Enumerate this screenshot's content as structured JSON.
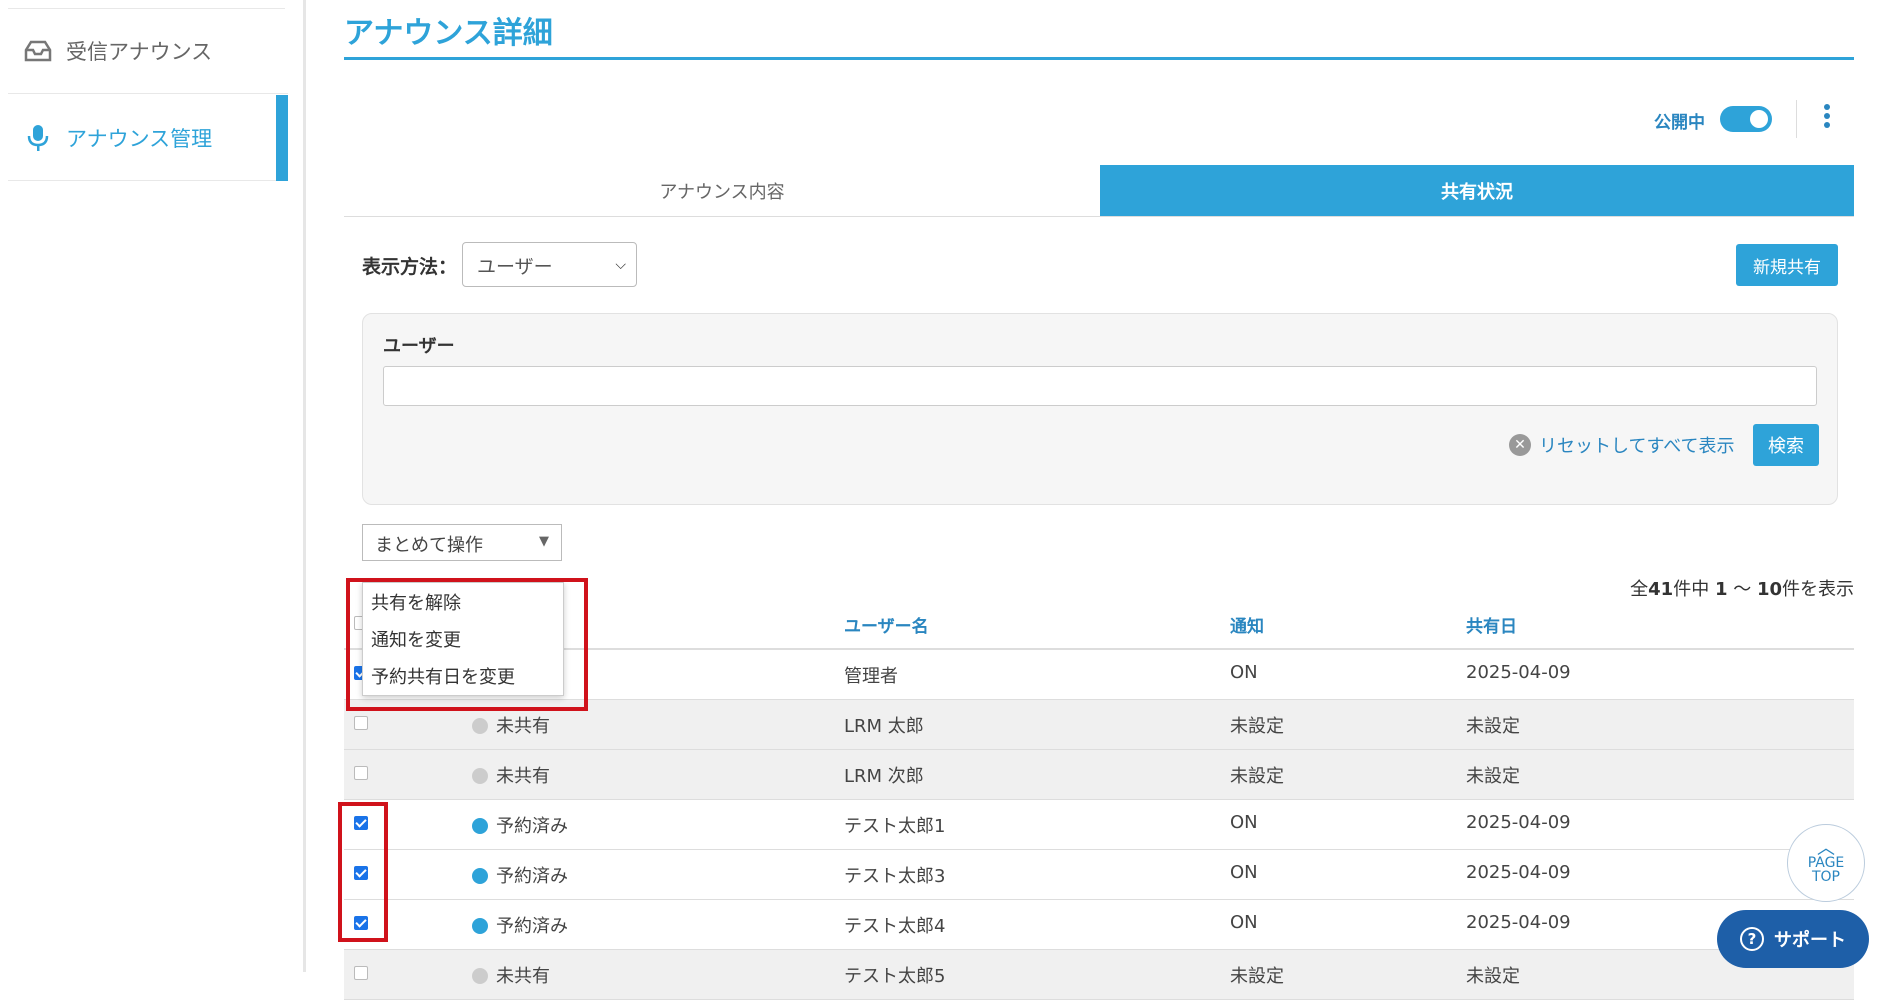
{
  "sidebar": {
    "items": [
      {
        "label": "受信アナウンス",
        "icon": "inbox-icon",
        "active": false
      },
      {
        "label": "アナウンス管理",
        "icon": "microphone-icon",
        "active": true
      }
    ]
  },
  "header": {
    "title": "アナウンス詳細",
    "publish_label": "公開中",
    "publish_on": true
  },
  "tabs": [
    {
      "label": "アナウンス内容",
      "active": false
    },
    {
      "label": "共有状況",
      "active": true
    }
  ],
  "display": {
    "label": "表示方法：",
    "selected": "ユーザー",
    "new_share_label": "新規共有"
  },
  "filter": {
    "label": "ユーザー",
    "value": "",
    "reset_label": "リセットしてすべて表示",
    "search_label": "検索"
  },
  "bulk": {
    "label": "まとめて操作",
    "options": [
      "共有を解除",
      "通知を変更",
      "予約共有日を変更"
    ]
  },
  "pager": {
    "prefix": "全",
    "total": "41",
    "mid1": "件中 ",
    "from": "1",
    "mid2": " ～ ",
    "to": "10",
    "suffix": "件を表示"
  },
  "table": {
    "columns": [
      "ユーザー名",
      "通知",
      "共有日"
    ],
    "rows": [
      {
        "checked": true,
        "status": "",
        "user": "管理者",
        "notify": "ON",
        "date": "2025-04-09",
        "gray": false
      },
      {
        "checked": false,
        "status": "未共有",
        "user": "LRM 太郎",
        "notify": "未設定",
        "date": "未設定",
        "gray": true
      },
      {
        "checked": false,
        "status": "未共有",
        "user": "LRM 次郎",
        "notify": "未設定",
        "date": "未設定",
        "gray": true
      },
      {
        "checked": true,
        "status": "予約済み",
        "user": "テスト太郎1",
        "notify": "ON",
        "date": "2025-04-09",
        "gray": false
      },
      {
        "checked": true,
        "status": "予約済み",
        "user": "テスト太郎3",
        "notify": "ON",
        "date": "2025-04-09",
        "gray": false
      },
      {
        "checked": true,
        "status": "予約済み",
        "user": "テスト太郎4",
        "notify": "ON",
        "date": "2025-04-09",
        "gray": false
      },
      {
        "checked": false,
        "status": "未共有",
        "user": "テスト太郎5",
        "notify": "未設定",
        "date": "未設定",
        "gray": true
      }
    ]
  },
  "colors": {
    "accent": "#2ea3d9",
    "link": "#2a86c0",
    "reserved_dot": "#2ea3d9",
    "unshared_dot": "#cccccc",
    "highlight": "#d0121b"
  },
  "floating": {
    "pagetop_line1": "PAGE",
    "pagetop_line2": "TOP",
    "support_label": "サポート"
  }
}
